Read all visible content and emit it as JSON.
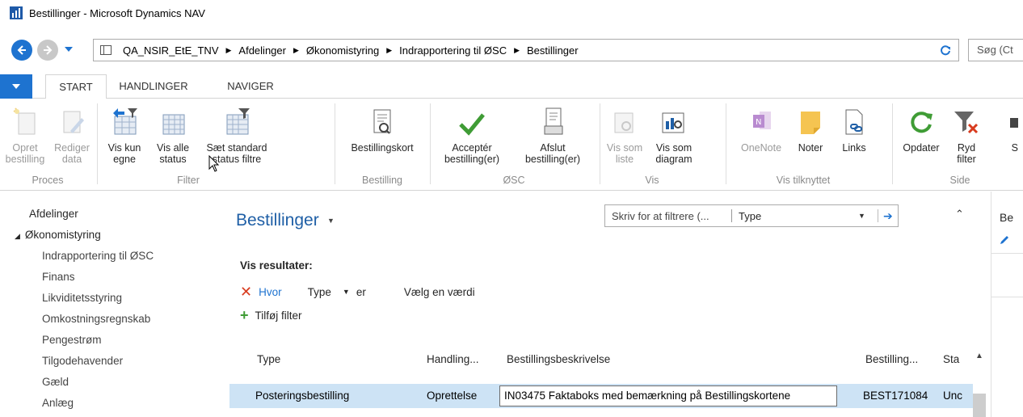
{
  "window": {
    "title": "Bestillinger - Microsoft Dynamics NAV"
  },
  "address": {
    "breadcrumbs": [
      "QA_NSIR_EtE_TNV",
      "Afdelinger",
      "Økonomistyring",
      "Indrapportering til ØSC",
      "Bestillinger"
    ],
    "search_placeholder": "Søg (Ct"
  },
  "ribbon": {
    "tabs": [
      "START",
      "HANDLINGER",
      "NAVIGER"
    ],
    "active_tab": "START",
    "groups": {
      "proces": "Proces",
      "filter": "Filter",
      "bestilling": "Bestilling",
      "osc": "ØSC",
      "vis": "Vis",
      "vis_tilknyttet": "Vis tilknyttet",
      "side": "Side"
    },
    "buttons": {
      "opret_1": "Opret",
      "opret_2": "bestilling",
      "rediger_1": "Rediger",
      "rediger_2": "data",
      "vis_kun_1": "Vis kun",
      "vis_kun_2": "egne",
      "vis_alle_1": "Vis alle",
      "vis_alle_2": "status",
      "saet_1": "Sæt standard",
      "saet_2": "status filtre",
      "bestillingskort": "Bestillingskort",
      "accepter_1": "Acceptér",
      "accepter_2": "bestilling(er)",
      "afslut_1": "Afslut",
      "afslut_2": "bestilling(er)",
      "vis_liste_1": "Vis som",
      "vis_liste_2": "liste",
      "vis_diagram_1": "Vis som",
      "vis_diagram_2": "diagram",
      "onenote": "OneNote",
      "noter": "Noter",
      "links": "Links",
      "opdater": "Opdater",
      "ryd_1": "Ryd",
      "ryd_2": "filter",
      "s": "S"
    }
  },
  "nav": {
    "root": "Afdelinger",
    "section": "Økonomistyring",
    "items": [
      "Indrapportering til ØSC",
      "Finans",
      "Likviditetsstyring",
      "Omkostningsregnskab",
      "Pengestrøm",
      "Tilgodehavender",
      "Gæld",
      "Anlæg"
    ]
  },
  "page": {
    "title": "Bestillinger",
    "filter_placeholder": "Skriv for at filtrere (...",
    "filter_field": "Type",
    "vis_resultater": "Vis resultater:",
    "filter": {
      "where": "Hvor",
      "field": "Type",
      "op": "er",
      "value": "Vælg en værdi"
    },
    "add_filter": "Tilføj filter"
  },
  "table": {
    "columns": [
      "Type",
      "Handling...",
      "Bestillingsbeskrivelse",
      "Bestilling...",
      "Sta"
    ],
    "rows": [
      {
        "type": "Posteringsbestilling",
        "handling": "Oprettelse",
        "beskrivelse": "IN03475 Faktaboks med bemærkning på Bestillingskortene",
        "bestilling": "BEST171084",
        "status": "Unc"
      }
    ]
  },
  "factbox": {
    "title": "Be"
  },
  "colors": {
    "accent": "#1e73d0",
    "title_blue": "#1f5fa6",
    "selected_row": "#cde3f5",
    "remove": "#d83b1e",
    "add": "#3f9c35"
  }
}
